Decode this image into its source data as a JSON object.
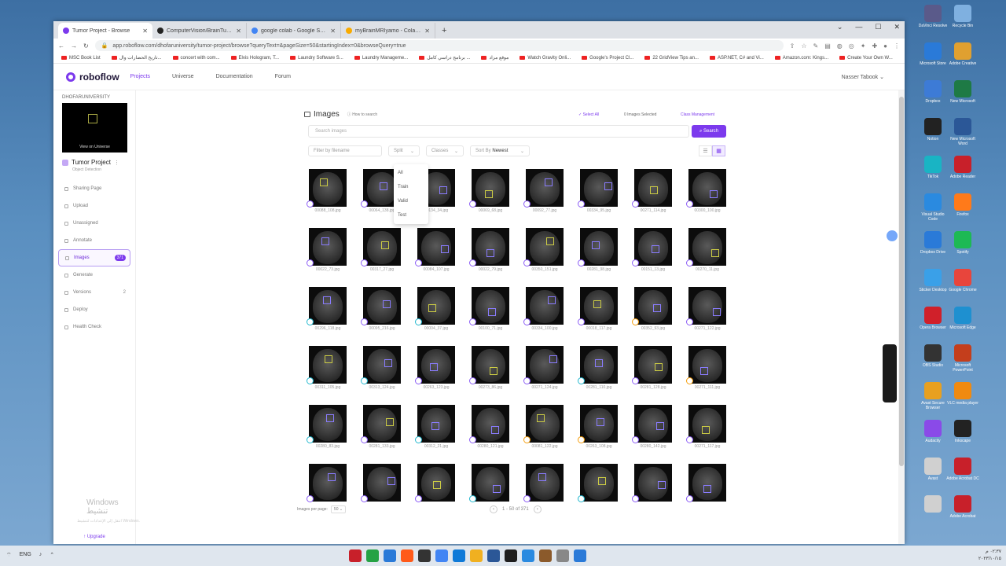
{
  "browser": {
    "tabs": [
      {
        "title": "Tumor Project - Browse",
        "color": "#7c3aed",
        "active": true
      },
      {
        "title": "ComputerVision/BrainTumorPro...",
        "color": "#222",
        "active": false
      },
      {
        "title": "google colab - Google Search",
        "color": "#4285f4",
        "active": false
      },
      {
        "title": "myBrainMRIyamo - Colaborator",
        "color": "#f9ab00",
        "active": false
      }
    ],
    "new_tab": "+",
    "url": "app.roboflow.com/dhofaruniversity/tumor-project/browse?queryText=&pageSize=50&startingIndex=0&browseQuery=true",
    "bookmarks": [
      "MSC Book List",
      "تاريخ الحضارات وال...",
      "concert with com...",
      "Elvis Hologram, T...",
      "Laundry Software S...",
      "Laundry Manageme...",
      "برنامج دراسي كامل ...",
      "موقع مزاد",
      "Watch Gravity Onli...",
      "Google's Project Cl...",
      "22 GridView Tips an...",
      "ASP.NET, C# and Vi...",
      "Amazon.com: Kings...",
      "Create Your Own W..."
    ]
  },
  "app": {
    "logo": "roboflow",
    "nav": [
      {
        "label": "Projects",
        "active": true
      },
      {
        "label": "Universe",
        "active": false
      },
      {
        "label": "Documentation",
        "active": false
      },
      {
        "label": "Forum",
        "active": false
      }
    ],
    "user": "Nasser Tabook"
  },
  "sidebar": {
    "workspace": "DHOFARUNIVERSITY",
    "thumb_label": "View on Universe",
    "project_name": "Tumor Project",
    "project_type": "Object Detection",
    "items": [
      {
        "label": "Sharing Page"
      },
      {
        "label": "Upload"
      },
      {
        "label": "Unassigned"
      },
      {
        "label": "Annotate"
      },
      {
        "label": "Images",
        "badge": "371",
        "active": true
      },
      {
        "label": "Generate"
      },
      {
        "label": "Versions",
        "count": "2"
      },
      {
        "label": "Deploy"
      },
      {
        "label": "Health Check"
      }
    ],
    "activate_title": "Windows تنشيط",
    "activate_sub": "انتقل إلى الإعدادات لتنشيط Windows.",
    "upgrade": "Upgrade"
  },
  "main": {
    "title": "Images",
    "how_to": "How to search",
    "select_all": "Select All",
    "selected": "0 Images Selected",
    "class_mgmt": "Class Management",
    "search_placeholder": "Search images",
    "search_btn": "Search",
    "filter_placeholder": "Filter by filename",
    "split_label": "Split",
    "classes_label": "Classes",
    "sort_prefix": "Sort By",
    "sort_value": "Newest",
    "split_options": [
      "All",
      "Train",
      "Valid",
      "Test"
    ],
    "per_page_label": "Images per page:",
    "per_page": "50",
    "range": "1 - 50 of 371"
  },
  "images": [
    {
      "fn": "00088_108.jpg",
      "s": "p"
    },
    {
      "fn": "00064_138.jpg",
      "s": "p"
    },
    {
      "fn": "00134_34.jpg",
      "s": "p"
    },
    {
      "fn": "00069_68.jpg",
      "s": "p"
    },
    {
      "fn": "00092_77.jpg",
      "s": "p"
    },
    {
      "fn": "00334_95.jpg",
      "s": "p"
    },
    {
      "fn": "00271_114.jpg",
      "s": "p"
    },
    {
      "fn": "00300_100.jpg",
      "s": "p"
    },
    {
      "fn": "00022_73.jpg",
      "s": "p"
    },
    {
      "fn": "00317_27.jpg",
      "s": "p"
    },
    {
      "fn": "00084_107.jpg",
      "s": "p"
    },
    {
      "fn": "00022_79.jpg",
      "s": "p"
    },
    {
      "fn": "00350_151.jpg",
      "s": "p"
    },
    {
      "fn": "00281_98.jpg",
      "s": "p"
    },
    {
      "fn": "00151_13.jpg",
      "s": "p"
    },
    {
      "fn": "00270_11.jpg",
      "s": "p"
    },
    {
      "fn": "00296_118.jpg",
      "s": "v"
    },
    {
      "fn": "00095_216.jpg",
      "s": "p"
    },
    {
      "fn": "00004_37.jpg",
      "s": "v"
    },
    {
      "fn": "00100_71.jpg",
      "s": "p"
    },
    {
      "fn": "00334_100.jpg",
      "s": "p"
    },
    {
      "fn": "00018_117.jpg",
      "s": "p"
    },
    {
      "fn": "00352_93.jpg",
      "s": "t"
    },
    {
      "fn": "00271_122.jpg",
      "s": "p"
    },
    {
      "fn": "00311_105.jpg",
      "s": "v"
    },
    {
      "fn": "00313_124.jpg",
      "s": "v"
    },
    {
      "fn": "00263_123.jpg",
      "s": "p"
    },
    {
      "fn": "00273_86.jpg",
      "s": "p"
    },
    {
      "fn": "00271_124.jpg",
      "s": "p"
    },
    {
      "fn": "00281_110.jpg",
      "s": "v"
    },
    {
      "fn": "00281_128.jpg",
      "s": "p"
    },
    {
      "fn": "00271_111.jpg",
      "s": "t"
    },
    {
      "fn": "00280_83.jpg",
      "s": "v"
    },
    {
      "fn": "00281_133.jpg",
      "s": "p"
    },
    {
      "fn": "00312_21.jpg",
      "s": "v"
    },
    {
      "fn": "00280_121.jpg",
      "s": "p"
    },
    {
      "fn": "00081_122.jpg",
      "s": "t"
    },
    {
      "fn": "00263_108.jpg",
      "s": "t"
    },
    {
      "fn": "00280_142.jpg",
      "s": "p"
    },
    {
      "fn": "00271_117.jpg",
      "s": "p"
    },
    {
      "fn": "",
      "s": "p"
    },
    {
      "fn": "",
      "s": "p"
    },
    {
      "fn": "",
      "s": "p"
    },
    {
      "fn": "",
      "s": "v"
    },
    {
      "fn": "",
      "s": "p"
    },
    {
      "fn": "",
      "s": "v"
    },
    {
      "fn": "",
      "s": "p"
    },
    {
      "fn": "",
      "s": "p"
    }
  ],
  "desktop": [
    "DaVinci Resolve",
    "Recycle Bin",
    "Microsoft Store",
    "Adobe Creative",
    "Dropbox",
    "New Microsoft",
    "Notion",
    "New Microsoft Word",
    "TikTok",
    "Adobe Reader",
    "Visual Studio Code",
    "Firefox",
    "Dropbox Drive",
    "Spotify",
    "Sticker Desktop",
    "Google Chrome",
    "Opera Browser",
    "Microsoft Edge",
    "OBS Studio",
    "Microsoft PowerPoint",
    "Avast Secure Browser",
    "VLC media player",
    "Audacity",
    "Inkscape",
    "Avast",
    "Adobe Acrobat DC",
    "",
    "Adobe Acrobat"
  ],
  "taskbar": {
    "lang": "ENG",
    "clock_time": "٠٢:٣٧ م",
    "clock_date": "٢٠٢٣/١٠/١٥"
  }
}
